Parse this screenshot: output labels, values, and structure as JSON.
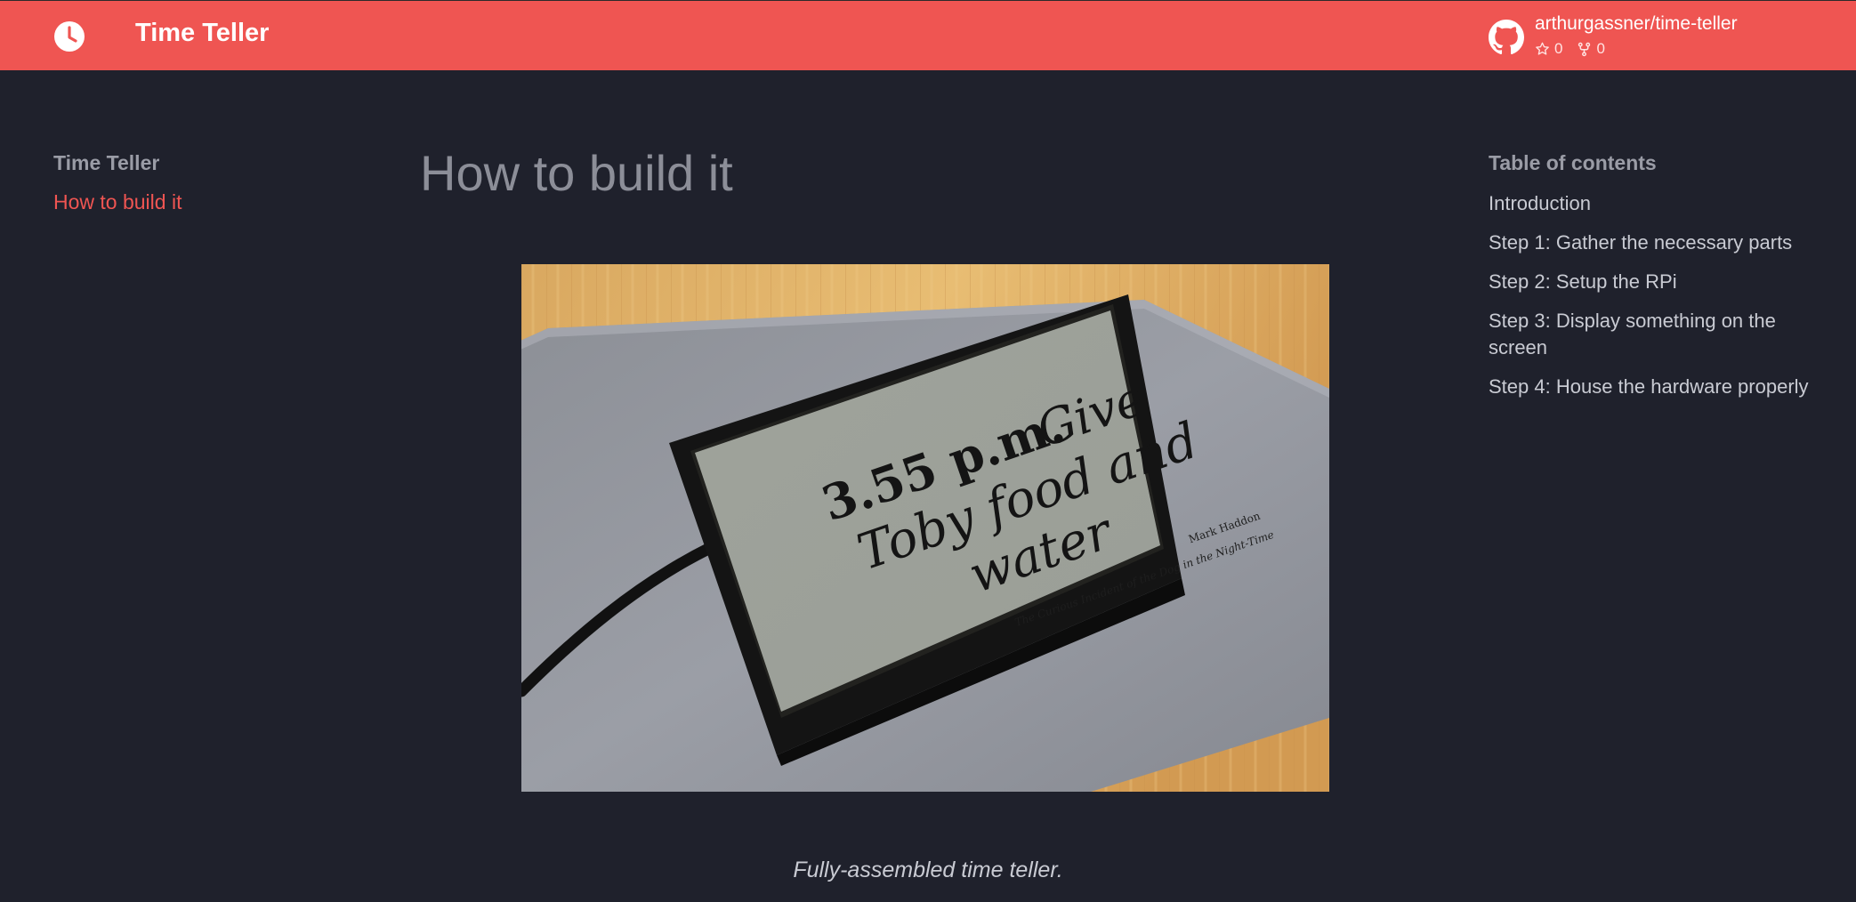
{
  "header": {
    "site_title": "Time Teller",
    "logo_icon": "clock-icon",
    "repo": {
      "icon": "github-icon",
      "name": "arthurgassner/time-teller",
      "stars": "0",
      "forks": "0"
    }
  },
  "sidebar": {
    "title": "Time Teller",
    "items": [
      {
        "label": "How to build it",
        "active": true
      }
    ]
  },
  "main": {
    "title": "How to build it",
    "figure": {
      "screen_text": {
        "time": "3.55 p.m.",
        "line1": "Give",
        "line2": "Toby food and",
        "line3": "water",
        "source": "The Curious Incident of the Dog in the Night-Time",
        "author": "Mark Haddon"
      },
      "caption": "Fully-assembled time teller."
    }
  },
  "toc": {
    "title": "Table of contents",
    "items": [
      "Introduction",
      "Step 1: Gather the necessary parts",
      "Step 2: Setup the RPi",
      "Step 3: Display something on the screen",
      "Step 4: House the hardware properly"
    ]
  },
  "colors": {
    "accent": "#ef5552",
    "background": "#1f212c",
    "text": "#c9cbd3",
    "muted": "#9a9ca6"
  }
}
